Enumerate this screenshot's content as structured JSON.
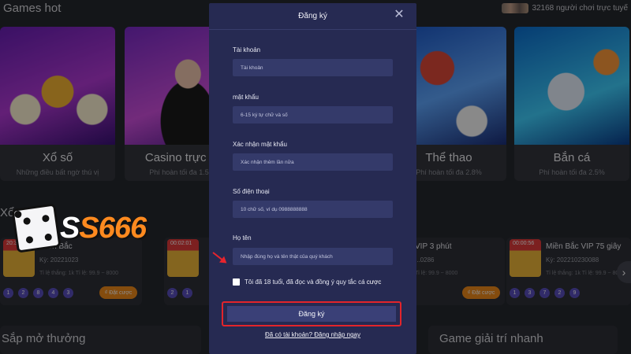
{
  "header": {
    "section_title": "Games hot",
    "players_online": "32168 người chơi trực tuyế"
  },
  "games": [
    {
      "name": "Xổ số",
      "subtitle": "Những điều bất ngờ thú vị"
    },
    {
      "name": "Casino trực tu",
      "subtitle": "Phí hoàn tối đa 1.5%"
    },
    {
      "name": "Thể thao",
      "subtitle": "Phí hoàn tối đa 2.8%"
    },
    {
      "name": "Bắn cá",
      "subtitle": "Phí hoàn tối đa 2.5%"
    }
  ],
  "logo": {
    "s": "S",
    "rest": "S666"
  },
  "lottery_section": {
    "title": "Xổ số"
  },
  "lottery_cards": [
    {
      "time": "20:37:11",
      "name": "Miền Bắc",
      "ky": "Kỳ: 20221023",
      "meta": "Tỉ lệ thắng: 1k    Tỉ lệ: 99.9 ~ 8000",
      "balls": [
        "1",
        "2",
        "8",
        "4",
        "3"
      ],
      "bet": "₫ Đặt cược"
    },
    {
      "time": "00:02:01",
      "name": "Miền Bắc VIP 5 phút",
      "ky": "Kỳ: 20221023...",
      "meta": "Tỉ lệ thắng: 1k",
      "balls": [
        "2",
        "1"
      ],
      "bet": ""
    },
    {
      "time": "",
      "name": "VIP 3 phút",
      "ky": "...0286",
      "meta": "Tỉ lệ: 99.9 ~ 8000",
      "balls": [
        "2",
        "6"
      ],
      "bet": "₫ Đặt cược"
    },
    {
      "time": "00:00:56",
      "name": "Miền Bắc VIP 75 giây",
      "ky": "Kỳ: 202210230088",
      "meta": "Tỉ lệ thắng: 1k    Tỉ lệ: 99.9 ~ 8000",
      "balls": [
        "1",
        "3",
        "7",
        "2",
        "9"
      ],
      "bet": "₫ Đặt cược"
    }
  ],
  "bottom": {
    "left_title": "Sắp mở thưởng",
    "right_title": "Game giải trí nhanh"
  },
  "modal": {
    "title": "Đăng ký",
    "close": "✕",
    "fields": [
      {
        "label": "Tài khoản",
        "placeholder": "Tài khoản"
      },
      {
        "label": "mật khẩu",
        "placeholder": "6-15 ký tự chữ và số"
      },
      {
        "label": "Xác nhận mật khẩu",
        "placeholder": "Xác nhận thêm lần nữa"
      },
      {
        "label": "Số điện thoại",
        "placeholder": "10 chữ số, ví dụ 0988888888"
      },
      {
        "label": "Họ tên",
        "placeholder": "Nhập đúng họ và tên thật của quý khách"
      }
    ],
    "agree_text": "Tôi đã 18 tuổi, đã đọc và đồng ý quy tắc cá",
    "agree_bold": "cược",
    "submit": "Đăng ký",
    "login_link": "Đã có tài khoản? Đăng nhập ngay"
  },
  "colors": {
    "accent_orange": "#f08a1a",
    "modal_bg": "#262a52",
    "highlight_red": "#e3242b"
  }
}
